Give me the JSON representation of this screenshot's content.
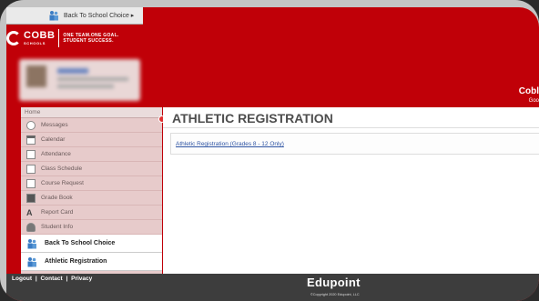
{
  "topbar": {
    "label": "Back To School Choice ▸"
  },
  "logo": {
    "name": "COBB",
    "sub": "SCHOOLS",
    "tagline_1": "ONE TEAM.ONE GOAL.",
    "tagline_2": "STUDENT SUCCESS."
  },
  "header_right": {
    "name": "Cobl",
    "sub": "Goo"
  },
  "sidebar": {
    "home": "Home",
    "items": [
      {
        "label": "Messages",
        "icon": "messages-icon"
      },
      {
        "label": "Calendar",
        "icon": "calendar-icon"
      },
      {
        "label": "Attendance",
        "icon": "attendance-icon"
      },
      {
        "label": "Class Schedule",
        "icon": "class-schedule-icon"
      },
      {
        "label": "Course Request",
        "icon": "course-request-icon"
      },
      {
        "label": "Grade Book",
        "icon": "grade-book-icon"
      },
      {
        "label": "Report Card",
        "icon": "report-card-icon"
      },
      {
        "label": "Student Info",
        "icon": "student-info-icon"
      }
    ],
    "back_to_school": "Back To School Choice",
    "athletic_registration": "Athletic Registration"
  },
  "main": {
    "title": "ATHLETIC REGISTRATION",
    "link": "Athletic Registration (Grades 8 - 12 Only)"
  },
  "footer": {
    "logout": "Logout",
    "contact": "Contact",
    "privacy": "Privacy",
    "sep": "|",
    "brand": "Edupoint",
    "copyright": "©Copyright 2020 Edupoint, LLC"
  },
  "colors": {
    "brand_red": "#c00008",
    "footer": "#3d3d3d",
    "link": "#2e54a3"
  }
}
